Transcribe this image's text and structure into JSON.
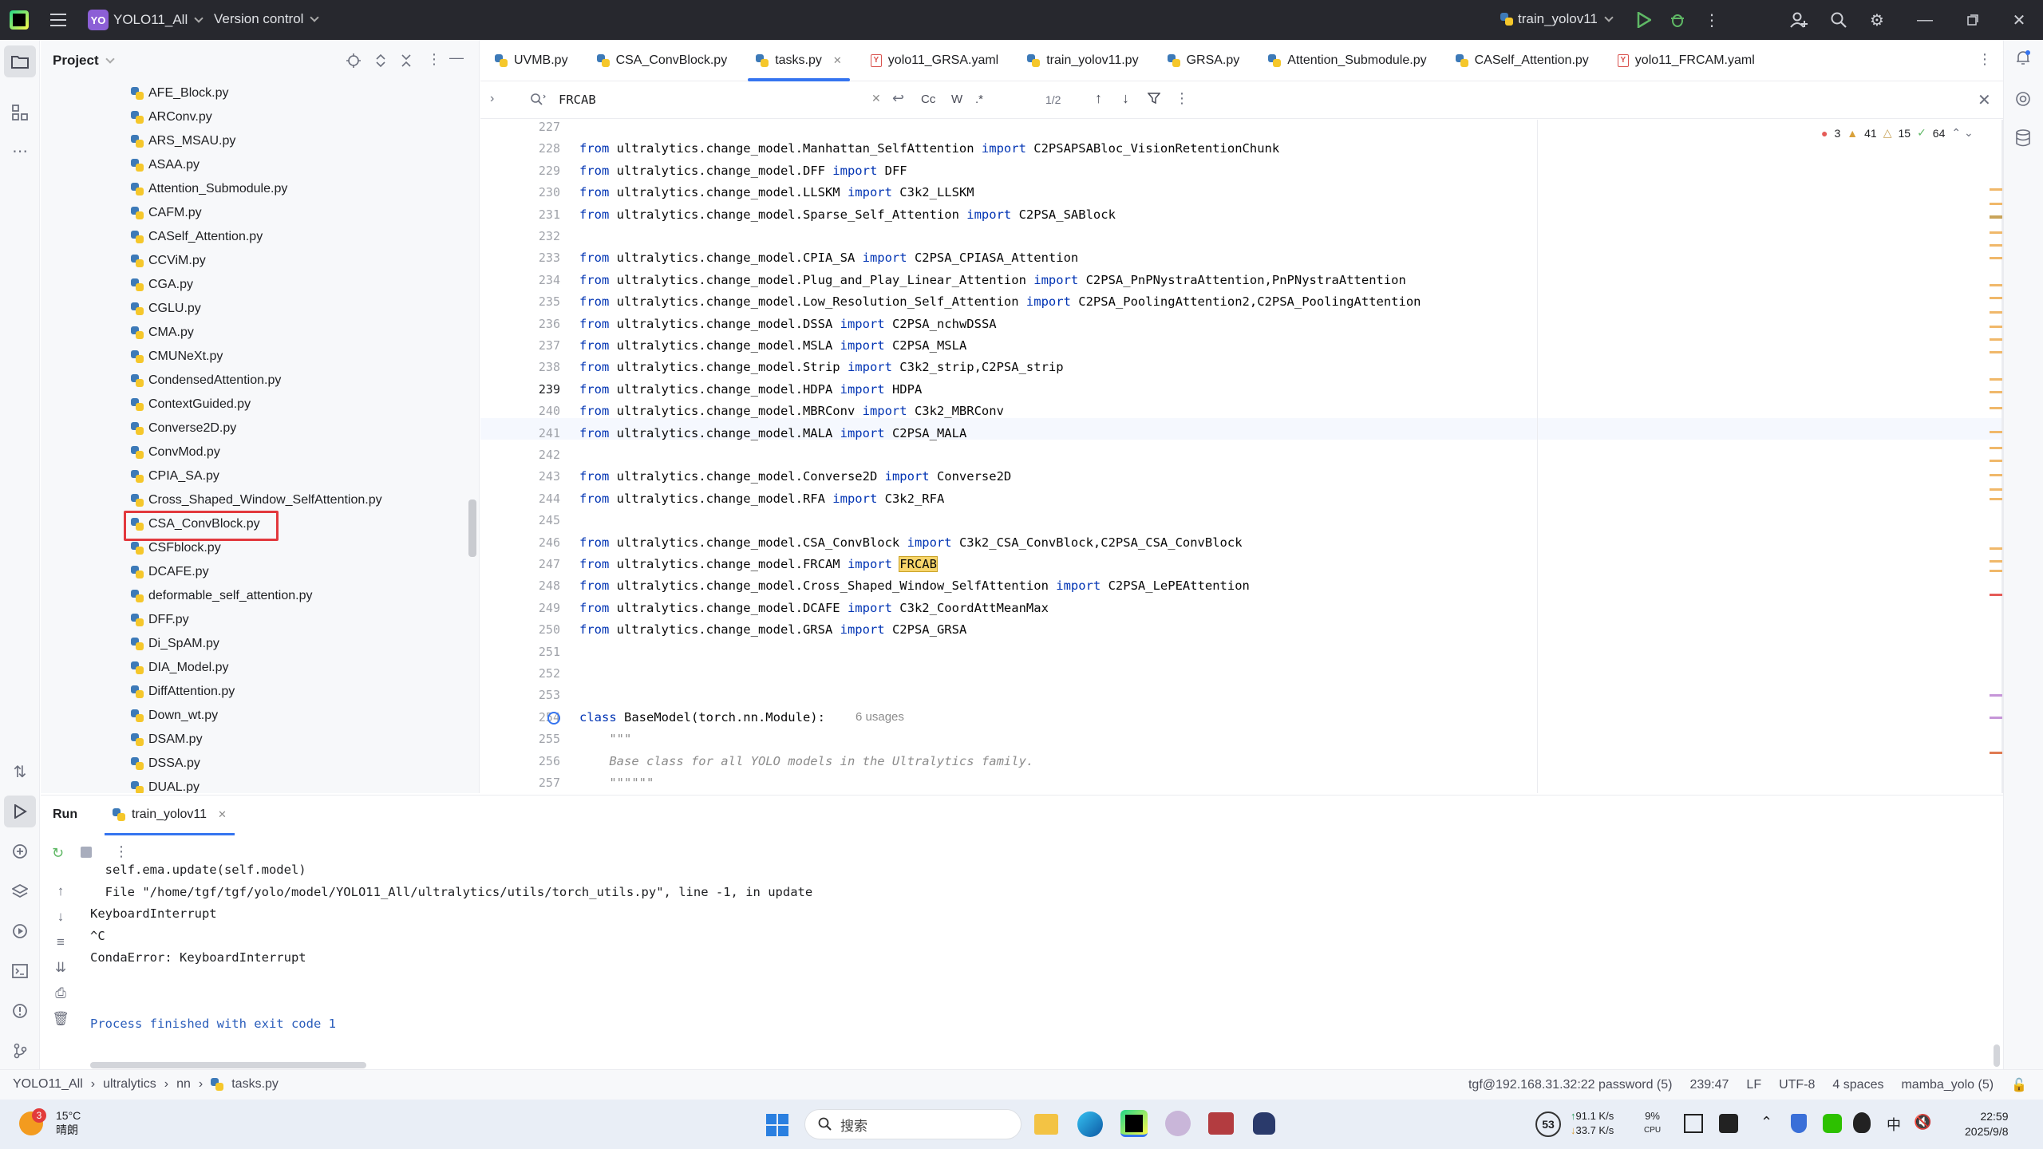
{
  "titlebar": {
    "project_badge": "YO",
    "project_name": "YOLO11_All",
    "vcs": "Version control",
    "run_config": "train_yolov11"
  },
  "project_panel": {
    "title": "Project",
    "files": [
      "AFE_Block.py",
      "ARConv.py",
      "ARS_MSAU.py",
      "ASAA.py",
      "Attention_Submodule.py",
      "CAFM.py",
      "CASelf_Attention.py",
      "CCViM.py",
      "CGA.py",
      "CGLU.py",
      "CMA.py",
      "CMUNeXt.py",
      "CondensedAttention.py",
      "ContextGuided.py",
      "Converse2D.py",
      "ConvMod.py",
      "CPIA_SA.py",
      "Cross_Shaped_Window_SelfAttention.py",
      "CSA_ConvBlock.py",
      "CSFblock.py",
      "DCAFE.py",
      "deformable_self_attention.py",
      "DFF.py",
      "Di_SpAM.py",
      "DIA_Model.py",
      "DiffAttention.py",
      "Down_wt.py",
      "DSAM.py",
      "DSSA.py",
      "DUAL.py"
    ]
  },
  "tabs": [
    "UVMB.py",
    "CSA_ConvBlock.py",
    "tasks.py",
    "yolo11_GRSA.yaml",
    "train_yolov11.py",
    "GRSA.py",
    "Attention_Submodule.py",
    "CASelf_Attention.py",
    "yolo11_FRCAM.yaml"
  ],
  "tab_types": [
    "py",
    "py",
    "py",
    "yaml",
    "py",
    "py",
    "py",
    "py",
    "yaml"
  ],
  "find": {
    "query": "FRCAB",
    "case": "Cc",
    "word": "W",
    "regex": ".*",
    "count": "1/2"
  },
  "inspections": {
    "errors": "3",
    "warnings": "41",
    "weak": "15",
    "ok": "64"
  },
  "code_lines": [
    {
      "n": "227",
      "t": ""
    },
    {
      "n": "228",
      "t": "from ultralytics.change_model.Manhattan_SelfAttention import C2PSAPSABloc_VisionRetentionChunk"
    },
    {
      "n": "229",
      "t": "from ultralytics.change_model.DFF import DFF"
    },
    {
      "n": "230",
      "t": "from ultralytics.change_model.LLSKM import C3k2_LLSKM"
    },
    {
      "n": "231",
      "t": "from ultralytics.change_model.Sparse_Self_Attention import C2PSA_SABlock"
    },
    {
      "n": "232",
      "t": ""
    },
    {
      "n": "233",
      "t": "from ultralytics.change_model.CPIA_SA import C2PSA_CPIASA_Attention"
    },
    {
      "n": "234",
      "t": "from ultralytics.change_model.Plug_and_Play_Linear_Attention import C2PSA_PnPNystraAttention,PnPNystraAttention"
    },
    {
      "n": "235",
      "t": "from ultralytics.change_model.Low_Resolution_Self_Attention import C2PSA_PoolingAttention2,C2PSA_PoolingAttention"
    },
    {
      "n": "236",
      "t": "from ultralytics.change_model.DSSA import C2PSA_nchwDSSA"
    },
    {
      "n": "237",
      "t": "from ultralytics.change_model.MSLA import C2PSA_MSLA"
    },
    {
      "n": "238",
      "t": "from ultralytics.change_model.Strip import C3k2_strip,C2PSA_strip"
    },
    {
      "n": "239",
      "t": "from ultralytics.change_model.HDPA import HDPA"
    },
    {
      "n": "240",
      "t": "from ultralytics.change_model.MBRConv import C3k2_MBRConv"
    },
    {
      "n": "241",
      "t": "from ultralytics.change_model.MALA import C2PSA_MALA"
    },
    {
      "n": "242",
      "t": ""
    },
    {
      "n": "243",
      "t": "from ultralytics.change_model.Converse2D import Converse2D"
    },
    {
      "n": "244",
      "t": "from ultralytics.change_model.RFA import C3k2_RFA"
    },
    {
      "n": "245",
      "t": ""
    },
    {
      "n": "246",
      "t": "from ultralytics.change_model.CSA_ConvBlock import C3k2_CSA_ConvBlock,C2PSA_CSA_ConvBlock"
    },
    {
      "n": "247",
      "t": "from ultralytics.change_model.FRCAM import FRCAB"
    },
    {
      "n": "248",
      "t": "from ultralytics.change_model.Cross_Shaped_Window_SelfAttention import C2PSA_LePEAttention"
    },
    {
      "n": "249",
      "t": "from ultralytics.change_model.DCAFE import C3k2_CoordAttMeanMax"
    },
    {
      "n": "250",
      "t": "from ultralytics.change_model.GRSA import C2PSA_GRSA"
    },
    {
      "n": "251",
      "t": ""
    },
    {
      "n": "252",
      "t": ""
    },
    {
      "n": "253",
      "t": ""
    },
    {
      "n": "254",
      "t": "class BaseModel(torch.nn.Module):"
    },
    {
      "n": "255",
      "t": "    \"\"\""
    },
    {
      "n": "256",
      "t": "    Base class for all YOLO models in the Ultralytics family."
    },
    {
      "n": "257",
      "t": "    \"\"\"\"\"\""
    }
  ],
  "usages": "6 usages",
  "run_panel": {
    "title": "Run",
    "tab": "train_yolov11",
    "lines": [
      "  self.ema.update(self.model)",
      "  File \"/home/tgf/tgf/yolo/model/YOLO11_All/ultralytics/utils/torch_utils.py\", line -1, in update",
      "KeyboardInterrupt",
      "^C",
      "CondaError: KeyboardInterrupt",
      "",
      "",
      "Process finished with exit code 1"
    ]
  },
  "statusbar": {
    "breadcrumbs": [
      "YOLO11_All",
      "ultralytics",
      "nn",
      "tasks.py"
    ],
    "remote": "tgf@192.168.31.32:22 password (5)",
    "position": "239:47",
    "line_sep": "LF",
    "encoding": "UTF-8",
    "indent": "4 spaces",
    "interpreter": "mamba_yolo (5)"
  },
  "taskbar": {
    "weather_temp": "15°C",
    "weather_desc": "晴朗",
    "weather_badge": "3",
    "search_placeholder": "搜索",
    "cpu_temp": "53",
    "net_up": "91.1 K/s",
    "net_down": "33.7 K/s",
    "cpu_pct": "9%",
    "cpu_label": "CPU",
    "ime": "中",
    "time": "22:59",
    "date": "2025/9/8"
  }
}
